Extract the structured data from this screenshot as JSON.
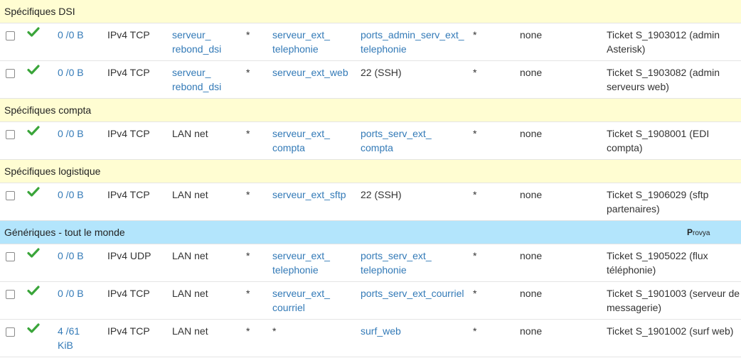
{
  "sections": [
    {
      "label": "Spécifiques DSI",
      "color": "yellow",
      "rules": [
        {
          "states": "0 /0 B",
          "protocol": "IPv4 TCP",
          "source": "serveur_\nrebond_dsi",
          "source_link": true,
          "port": "*",
          "destination": "serveur_ext_\ntelephonie",
          "dest_link": true,
          "dest_port": "ports_admin_serv_ext_\ntelephonie",
          "dest_port_link": true,
          "gateway": "*",
          "queue": "none",
          "description": "Ticket S_1903012 (admin\nAsterisk)"
        },
        {
          "states": "0 /0 B",
          "protocol": "IPv4 TCP",
          "source": "serveur_\nrebond_dsi",
          "source_link": true,
          "port": "*",
          "destination": "serveur_ext_web",
          "dest_link": true,
          "dest_port": "22 (SSH)",
          "dest_port_link": false,
          "gateway": "*",
          "queue": "none",
          "description": "Ticket S_1903082 (admin\nserveurs web)"
        }
      ]
    },
    {
      "label": "Spécifiques compta",
      "color": "yellow",
      "rules": [
        {
          "states": "0 /0 B",
          "protocol": "IPv4 TCP",
          "source": "LAN net",
          "source_link": false,
          "port": "*",
          "destination": "serveur_ext_\ncompta",
          "dest_link": true,
          "dest_port": "ports_serv_ext_\ncompta",
          "dest_port_link": true,
          "gateway": "*",
          "queue": "none",
          "description": "Ticket S_1908001 (EDI\ncompta)"
        }
      ]
    },
    {
      "label": "Spécifiques logistique",
      "color": "yellow",
      "rules": [
        {
          "states": "0 /0 B",
          "protocol": "IPv4 TCP",
          "source": "LAN net",
          "source_link": false,
          "port": "*",
          "destination": "serveur_ext_sftp",
          "dest_link": true,
          "dest_port": "22 (SSH)",
          "dest_port_link": false,
          "gateway": "*",
          "queue": "none",
          "description": "Ticket S_1906029 (sftp\npartenaires)"
        }
      ]
    },
    {
      "label": "Génériques - tout le monde",
      "color": "blue",
      "logo": "Provya",
      "rules": [
        {
          "states": "0 /0 B",
          "protocol": "IPv4 UDP",
          "source": "LAN net",
          "source_link": false,
          "port": "*",
          "destination": "serveur_ext_\ntelephonie",
          "dest_link": true,
          "dest_port": "ports_serv_ext_\ntelephonie",
          "dest_port_link": true,
          "gateway": "*",
          "queue": "none",
          "description": "Ticket S_1905022 (flux\ntéléphonie)"
        },
        {
          "states": "0 /0 B",
          "protocol": "IPv4 TCP",
          "source": "LAN net",
          "source_link": false,
          "port": "*",
          "destination": "serveur_ext_\ncourriel",
          "dest_link": true,
          "dest_port": "ports_serv_ext_courriel",
          "dest_port_link": true,
          "gateway": "*",
          "queue": "none",
          "description": "Ticket S_1901003 (serveur de\nmessagerie)"
        },
        {
          "states": "4 /61\nKiB",
          "protocol": "IPv4 TCP",
          "source": "LAN net",
          "source_link": false,
          "port": "*",
          "destination": "*",
          "dest_link": false,
          "dest_port": "surf_web",
          "dest_port_link": true,
          "gateway": "*",
          "queue": "none",
          "description": "Ticket S_1901002 (surf web)"
        }
      ]
    }
  ],
  "icons": {
    "row_check": "check-icon",
    "check_color": "#3aa53a",
    "link_color": "#337ab7"
  }
}
